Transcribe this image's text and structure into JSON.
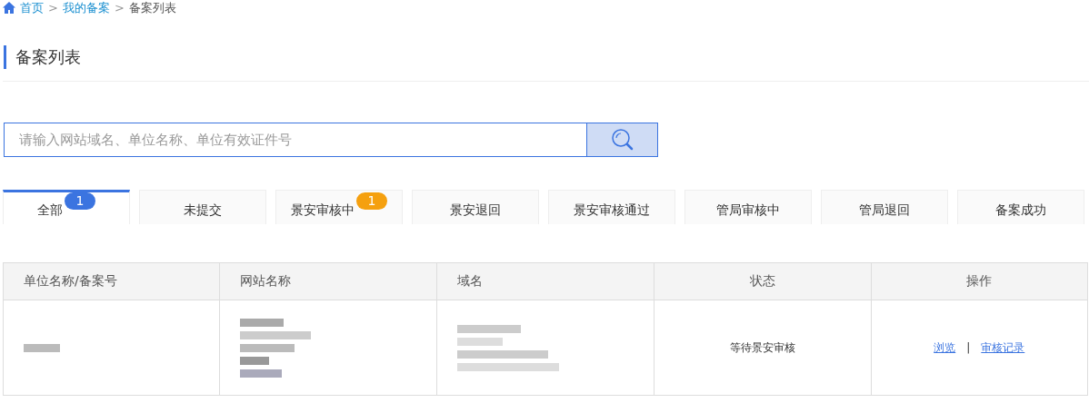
{
  "breadcrumb": [
    {
      "label": "首页",
      "link": true
    },
    {
      "label": "我的备案",
      "link": true
    },
    {
      "label": "备案列表",
      "link": false
    }
  ],
  "separator": ">",
  "title": "备案列表",
  "search": {
    "placeholder": "请输入网站域名、单位名称、单位有效证件号"
  },
  "tabs": [
    {
      "label": "全部",
      "selected": true,
      "badge": "1",
      "color": "#3b74e0"
    },
    {
      "label": "未提交",
      "selected": false
    },
    {
      "label": "景安审核中",
      "selected": false,
      "badge": "1",
      "color": "#f5a00f"
    },
    {
      "label": "景安退回",
      "selected": false
    },
    {
      "label": "景安审核通过",
      "selected": false
    },
    {
      "label": "管局审核中",
      "selected": false
    },
    {
      "label": "管局退回",
      "selected": false
    },
    {
      "label": "备案成功",
      "selected": false
    }
  ],
  "table": {
    "columns": [
      "单位名称/备案号",
      "网站名称",
      "域名",
      "状态",
      "操作"
    ],
    "rows": [
      {
        "cells": [
          {
            "kind": "blurred"
          },
          {
            "kind": "blurred"
          },
          {
            "kind": "blurred"
          },
          {
            "kind": "text",
            "text": "等待景安审核"
          },
          {
            "kind": "actions",
            "links": [
              "浏览",
              "审核记录"
            ],
            "separator": "|"
          }
        ]
      }
    ]
  }
}
